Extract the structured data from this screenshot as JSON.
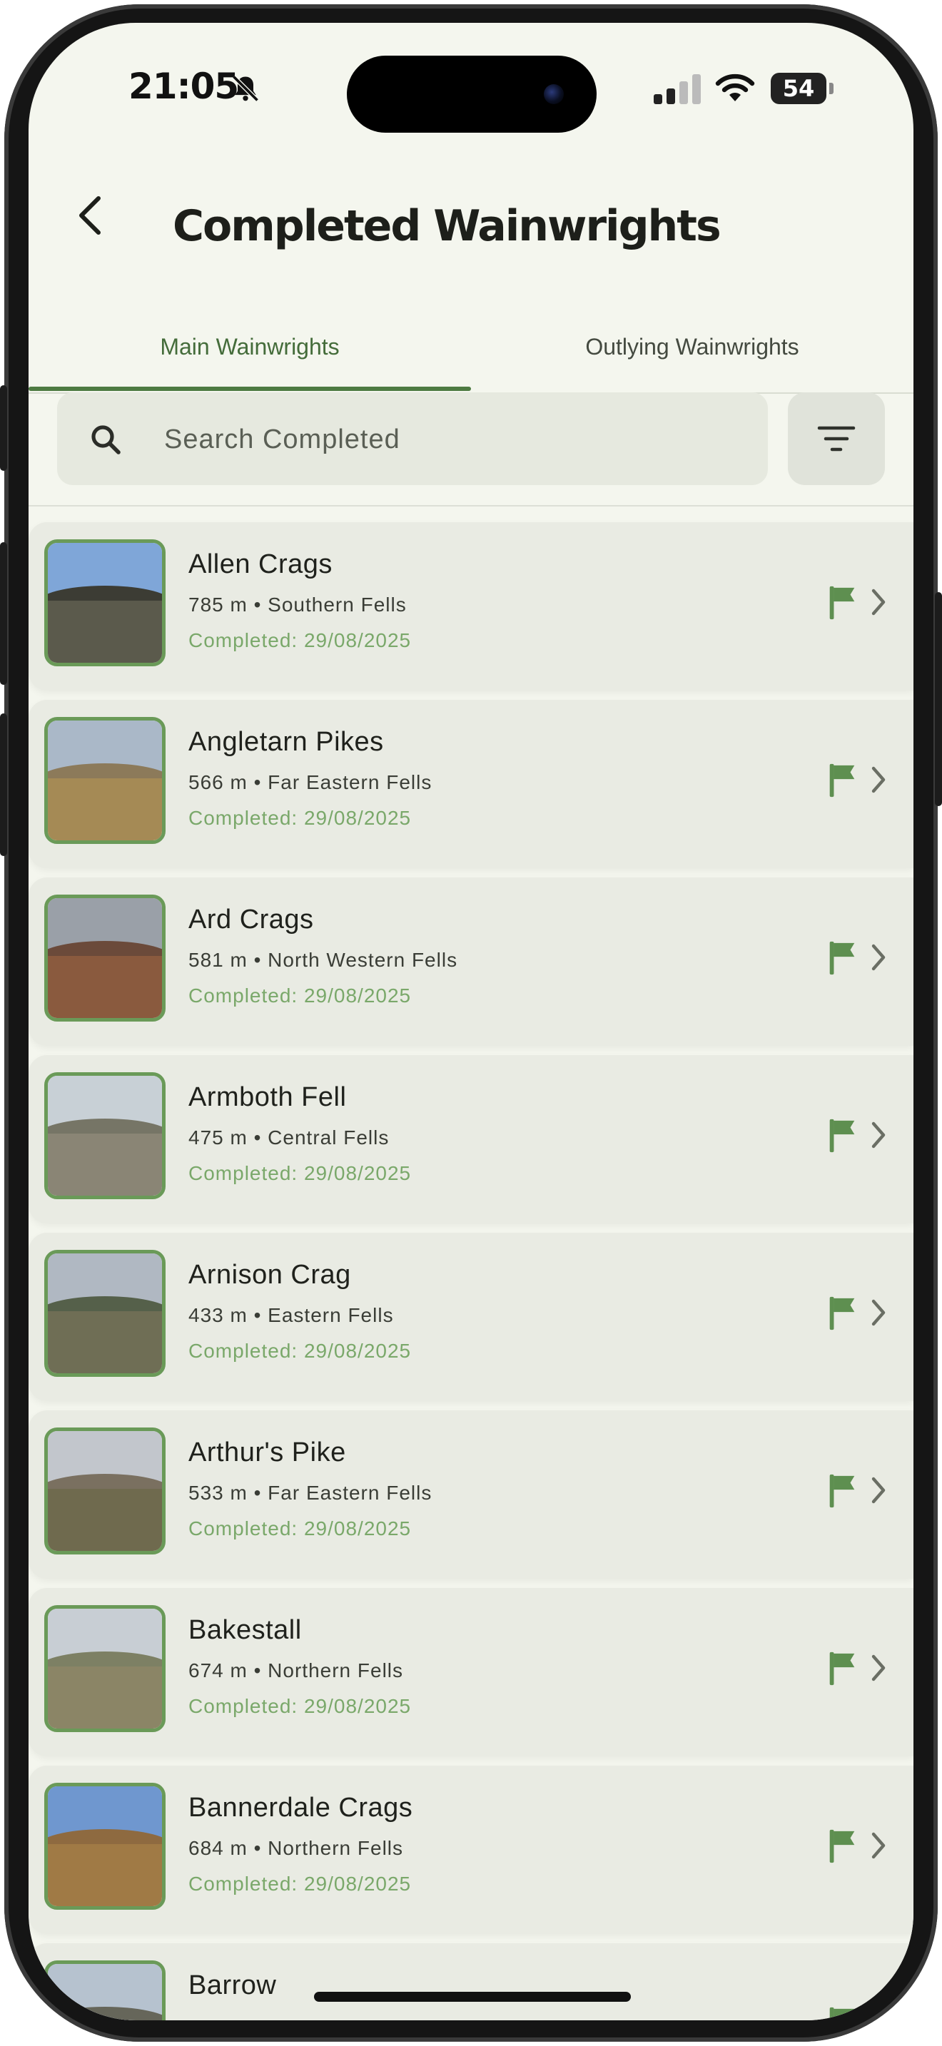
{
  "status_bar": {
    "time": "21:05",
    "battery": "54"
  },
  "header": {
    "title": "Completed Wainwrights"
  },
  "tabs": [
    {
      "label": "Main Wainwrights",
      "active": true
    },
    {
      "label": "Outlying Wainwrights",
      "active": false
    }
  ],
  "search": {
    "placeholder": "Search Completed"
  },
  "fells": [
    {
      "name": "Allen Crags",
      "meta": "785 m • Southern Fells",
      "completed": "Completed: 29/08/2025",
      "sky": "#7fa6d8",
      "land": "#5b5a4c",
      "ridge": "#3c3c34"
    },
    {
      "name": "Angletarn Pikes",
      "meta": "566 m • Far Eastern Fells",
      "completed": "Completed: 29/08/2025",
      "sky": "#aab8c8",
      "land": "#a58a55",
      "ridge": "#8c7a5a"
    },
    {
      "name": "Ard Crags",
      "meta": "581 m • North Western Fells",
      "completed": "Completed: 29/08/2025",
      "sky": "#9aa0a8",
      "land": "#8a5a3e",
      "ridge": "#6b4a3a"
    },
    {
      "name": "Armboth Fell",
      "meta": "475 m • Central Fells",
      "completed": "Completed: 29/08/2025",
      "sky": "#c8d0d6",
      "land": "#8a8575",
      "ridge": "#767566"
    },
    {
      "name": "Arnison Crag",
      "meta": "433 m • Eastern Fells",
      "completed": "Completed: 29/08/2025",
      "sky": "#b0b8c2",
      "land": "#6f6e55",
      "ridge": "#55604a"
    },
    {
      "name": "Arthur's Pike",
      "meta": "533 m • Far Eastern Fells",
      "completed": "Completed: 29/08/2025",
      "sky": "#c2c6cc",
      "land": "#6f6a4e",
      "ridge": "#7a7060"
    },
    {
      "name": "Bakestall",
      "meta": "674 m • Northern Fells",
      "completed": "Completed: 29/08/2025",
      "sky": "#c8ced4",
      "land": "#8b8566",
      "ridge": "#7d8064"
    },
    {
      "name": "Bannerdale Crags",
      "meta": "684 m • Northern Fells",
      "completed": "Completed: 29/08/2025",
      "sky": "#6f97cf",
      "land": "#a07a45",
      "ridge": "#8e6a40"
    },
    {
      "name": "Barrow",
      "meta": "",
      "completed": "",
      "sky": "#b6c2cf",
      "land": "#7a7a66",
      "ridge": "#66665a"
    }
  ],
  "colors": {
    "accent": "#4d7a41",
    "completed_text": "#7aa86a",
    "background": "#f4f6ee"
  }
}
